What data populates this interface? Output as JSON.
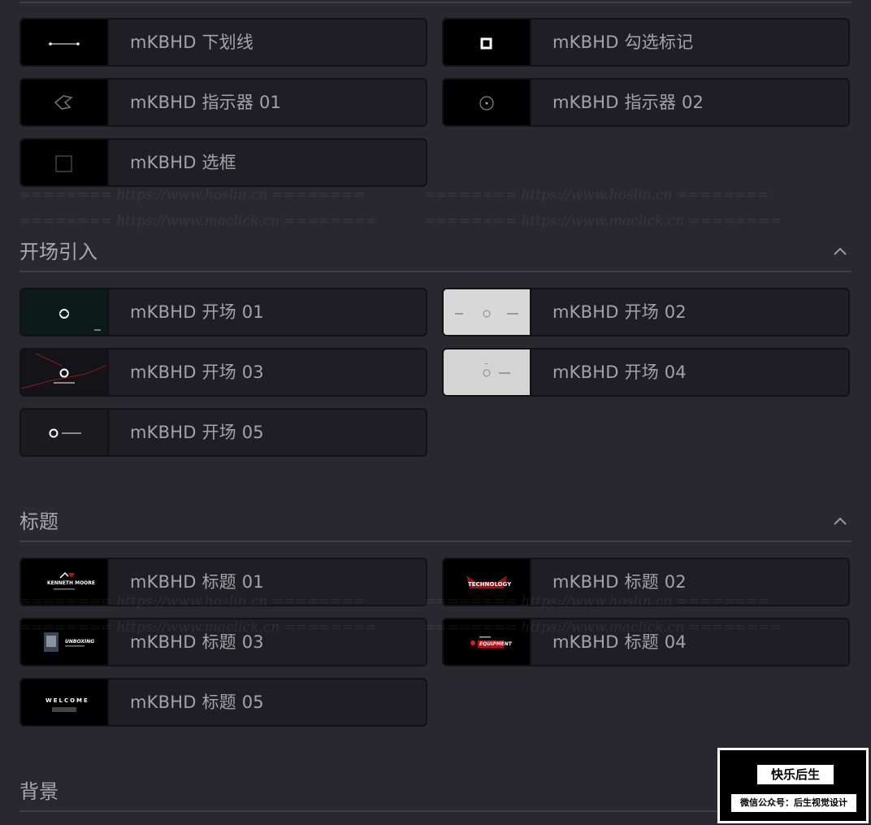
{
  "sections": [
    {
      "title": "",
      "items": [
        {
          "label": "mKBHD 下划线",
          "thumb": "underline"
        },
        {
          "label": "mKBHD 勾选标记",
          "thumb": "checkmark"
        },
        {
          "label": "mKBHD 指示器 01",
          "thumb": "indicator1"
        },
        {
          "label": "mKBHD 指示器 02",
          "thumb": "indicator2"
        },
        {
          "label": "mKBHD 选框",
          "thumb": "box"
        }
      ]
    },
    {
      "title": "开场引入",
      "items": [
        {
          "label": "mKBHD 开场 01",
          "thumb": "opener1"
        },
        {
          "label": "mKBHD 开场 02",
          "thumb": "opener2"
        },
        {
          "label": "mKBHD 开场 03",
          "thumb": "opener3"
        },
        {
          "label": "mKBHD 开场 04",
          "thumb": "opener4"
        },
        {
          "label": "mKBHD 开场 05",
          "thumb": "opener5"
        }
      ]
    },
    {
      "title": "标题",
      "items": [
        {
          "label": "mKBHD 标题 01",
          "thumb": "title1",
          "thumb_text": "KENNETH MOORE"
        },
        {
          "label": "mKBHD 标题 02",
          "thumb": "title2",
          "thumb_text": "TECHNOLOGY"
        },
        {
          "label": "mKBHD 标题 03",
          "thumb": "title3",
          "thumb_text": "UNBOXING"
        },
        {
          "label": "mKBHD 标题 04",
          "thumb": "title4",
          "thumb_text": "EQUIPMENT"
        },
        {
          "label": "mKBHD 标题 05",
          "thumb": "title5",
          "thumb_text": "WELCOME"
        }
      ]
    },
    {
      "title": "背景",
      "items": []
    }
  ],
  "watermark": {
    "line1": "======== https://www.hoslin.cn ========",
    "line2": "======== https://www.maclick.cn ========"
  },
  "badge": {
    "line1": "快乐后生",
    "line2": "微信公众号：后生视觉设计"
  },
  "colors": {
    "background": "#28282e",
    "item_bg": "#1e1e24",
    "text": "#a3a3a8",
    "accent_red": "#c0101a"
  }
}
